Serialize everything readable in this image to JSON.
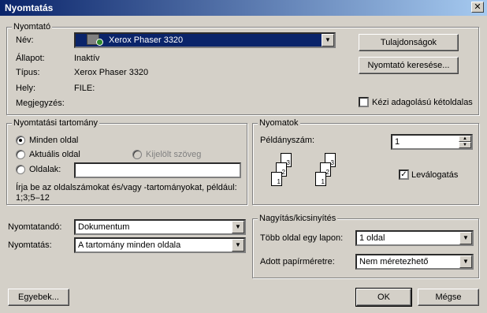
{
  "window": {
    "title": "Nyomtatás",
    "close": "✕"
  },
  "printer": {
    "group_label": "Nyomtató",
    "name_label": "Név:",
    "name_value": "Xerox Phaser 3320",
    "status_label": "Állapot:",
    "status_value": "Inaktív",
    "type_label": "Típus:",
    "type_value": "Xerox Phaser 3320",
    "where_label": "Hely:",
    "where_value": "FILE:",
    "comment_label": "Megjegyzés:",
    "properties_button": "Tulajdonságok",
    "find_printer_button": "Nyomtató keresése...",
    "manual_duplex_label": "Kézi adagolású kétoldalas",
    "manual_duplex_checked": false
  },
  "page_range": {
    "group_label": "Nyomtatási tartomány",
    "all_label": "Minden oldal",
    "current_label": "Aktuális oldal",
    "selection_label": "Kijelölt szöveg",
    "pages_label": "Oldalak:",
    "pages_value": "",
    "hint": "Írja be az oldalszámokat és/vagy -tartományokat, például: 1;3;5–12",
    "selected": "all"
  },
  "copies": {
    "group_label": "Nyomatok",
    "count_label": "Példányszám:",
    "count_value": "1",
    "collate_label": "Leválogatás",
    "collate_checked": true,
    "page_numbers": [
      "3",
      "2",
      "1",
      "3",
      "2",
      "1"
    ]
  },
  "print_what": {
    "label": "Nyomtatandó:",
    "value": "Dokumentum"
  },
  "print": {
    "label": "Nyomtatás:",
    "value": "A tartomány minden oldala"
  },
  "zoom": {
    "group_label": "Nagyítás/kicsinyítés",
    "pages_per_sheet_label": "Több oldal egy lapon:",
    "pages_per_sheet_value": "1 oldal",
    "scale_label": "Adott papírméretre:",
    "scale_value": "Nem méretezhető"
  },
  "footer": {
    "options_button": "Egyebek...",
    "ok_button": "OK",
    "cancel_button": "Mégse"
  }
}
